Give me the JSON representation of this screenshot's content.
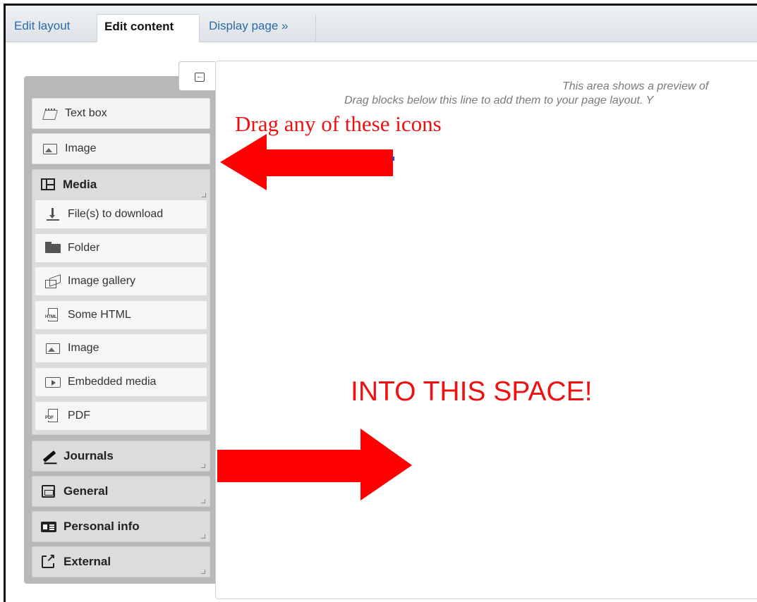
{
  "tabs": [
    {
      "label": "Edit layout"
    },
    {
      "label": "Edit content"
    },
    {
      "label": "Display page »"
    }
  ],
  "palette": {
    "collapse_icon": "collapse-sidebar-icon",
    "top_items": [
      {
        "label": "Text box",
        "icon": "text-box-icon"
      },
      {
        "label": "Image",
        "icon": "image-icon"
      }
    ],
    "media": {
      "label": "Media",
      "icon": "film-icon",
      "items": [
        {
          "label": "File(s) to download",
          "icon": "download-icon"
        },
        {
          "label": "Folder",
          "icon": "folder-icon"
        },
        {
          "label": "Image gallery",
          "icon": "gallery-icon"
        },
        {
          "label": "Some HTML",
          "icon": "html-icon"
        },
        {
          "label": "Image",
          "icon": "image-icon"
        },
        {
          "label": "Embedded media",
          "icon": "embed-icon"
        },
        {
          "label": "PDF",
          "icon": "pdf-icon"
        }
      ]
    },
    "categories": [
      {
        "label": "Journals",
        "icon": "pen-icon"
      },
      {
        "label": "General",
        "icon": "calendar-icon"
      },
      {
        "label": "Personal info",
        "icon": "id-card-icon"
      },
      {
        "label": "External",
        "icon": "external-link-icon"
      }
    ]
  },
  "canvas": {
    "hint_line1": "This area shows a preview of",
    "hint_line2": "Drag blocks below this line to add them to your page layout. Y"
  },
  "annotations": {
    "drag_text": "Drag any of these icons",
    "space_text": "INTO THIS SPACE!",
    "color": "#ee1111"
  }
}
